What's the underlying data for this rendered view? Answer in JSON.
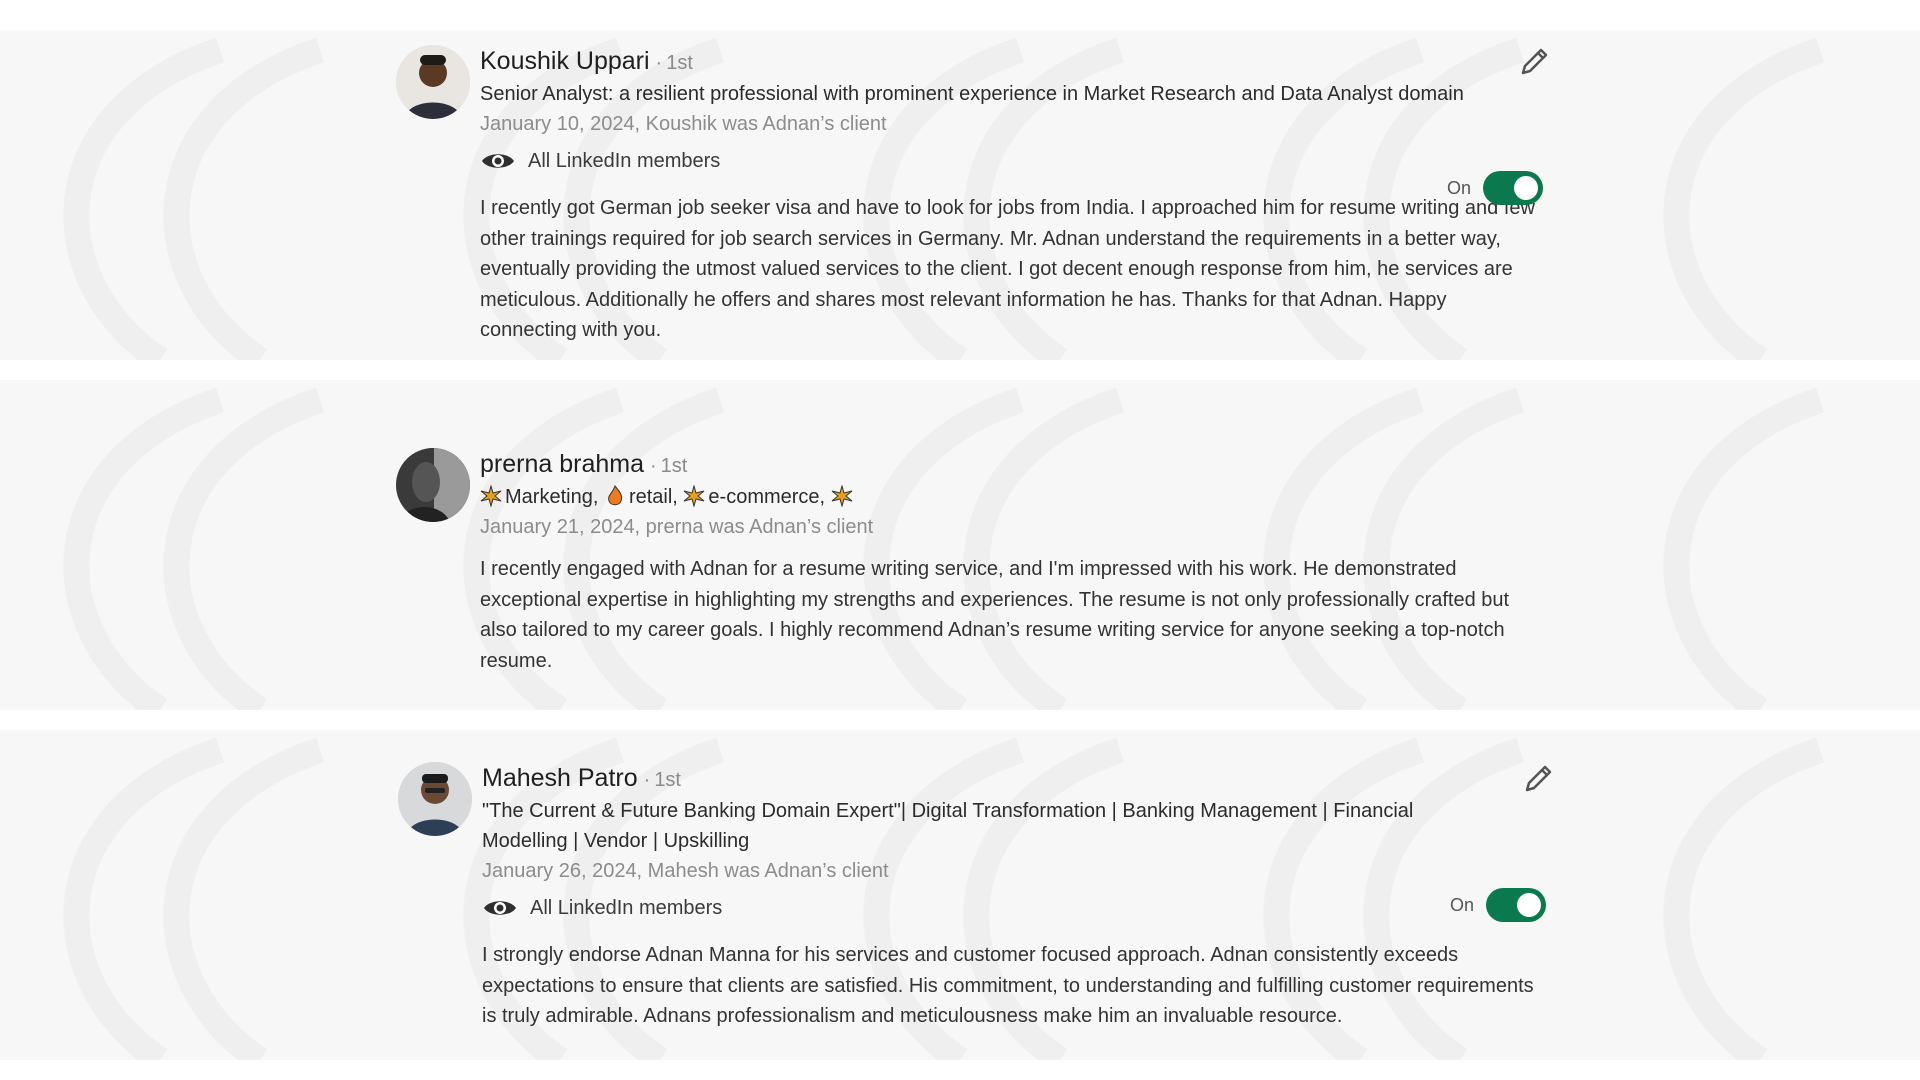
{
  "recommendations": [
    {
      "name": "Koushik Uppari",
      "separator": "·",
      "degree": "1st",
      "headline": "Senior Analyst: a resilient professional with prominent experience in Market Research and Data Analyst domain",
      "date_relation": "January 10, 2024, Koushik was Adnan’s client",
      "visibility": "All LinkedIn members",
      "toggle_label": "On",
      "toggle_on": true,
      "text": "I recently got German job seeker visa and have to look for jobs from India. I approached him for resume writing and few other trainings required for job search services in Germany. Mr. Adnan understand the requirements in a better way, eventually providing the utmost valued services to the client. I got decent enough response from him, he services are meticulous. Additionally he offers and shares most relevant information he has. Thanks for that Adnan. Happy connecting with you."
    },
    {
      "name": "prerna brahma",
      "separator": "·",
      "degree": "1st",
      "headline_parts": [
        "Marketing,",
        "retail,",
        "e-commerce,"
      ],
      "date_relation": "January 21, 2024, prerna was Adnan’s client",
      "text": "I recently engaged with Adnan for a resume writing service, and I'm impressed with his work. He demonstrated exceptional expertise in highlighting my strengths and experiences. The resume is not only professionally crafted but also tailored to my career goals. I highly recommend Adnan’s resume writing service for anyone seeking a top-notch resume."
    },
    {
      "name": "Mahesh Patro",
      "separator": "·",
      "degree": "1st",
      "headline": "\"The Current & Future Banking Domain Expert\"| Digital Transformation | Banking Management | Financial Modelling | Vendor | Upskilling",
      "date_relation": "January 26, 2024, Mahesh was Adnan’s client",
      "visibility": "All LinkedIn members",
      "toggle_label": "On",
      "toggle_on": true,
      "text": "I strongly endorse Adnan Manna for his services and customer focused approach. Adnan consistently exceeds expectations to ensure that clients are satisfied. His commitment, to understanding and fulfilling customer requirements is truly admirable. Adnans professionalism and meticulousness make him an invaluable resource."
    }
  ],
  "icons": {
    "edit": "pencil-icon",
    "visibility": "eye-icon",
    "headline_emoji": [
      "sparkle-icon",
      "fire-icon",
      "sparkle-icon",
      "sparkle-icon"
    ]
  },
  "colors": {
    "toggle_on": "#0a7a4e",
    "muted_text": "#8c8c8c",
    "band_background": "#f7f7f7"
  }
}
